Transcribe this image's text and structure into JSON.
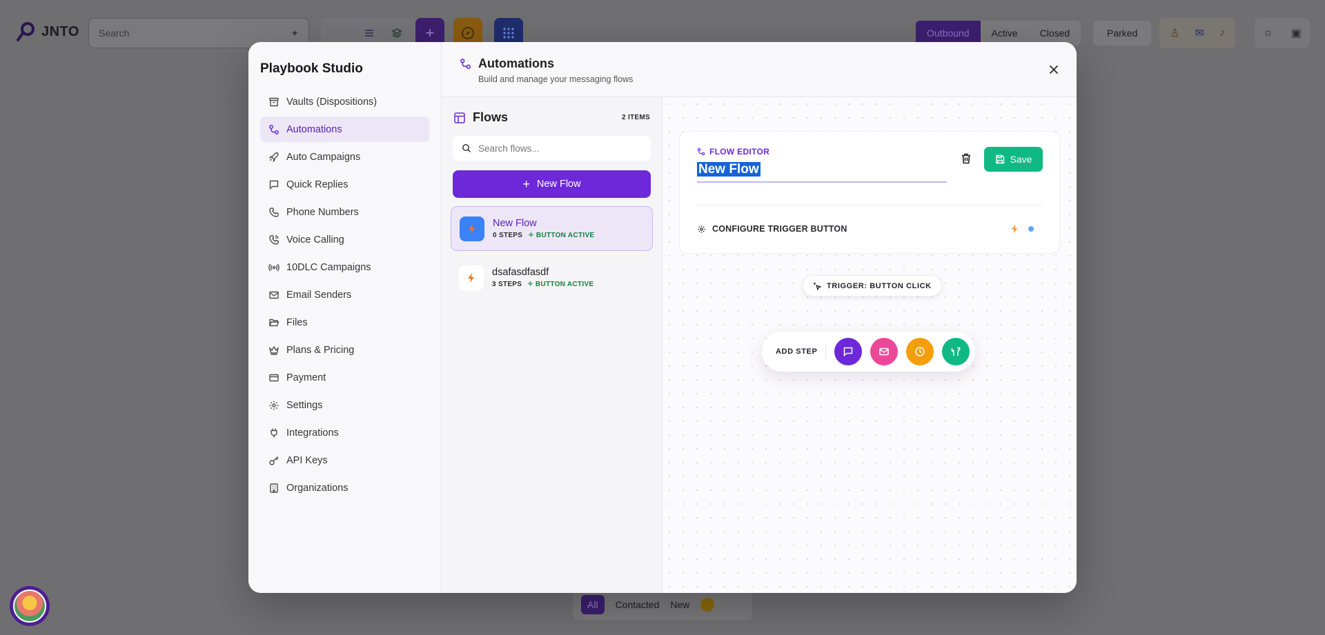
{
  "background": {
    "logo_text": "JNTO",
    "search_placeholder": "Search",
    "segments": [
      "Outbound",
      "Active",
      "Closed"
    ],
    "parked_label": "Parked",
    "bottom_tabs": [
      "All",
      "Contacted",
      "New"
    ]
  },
  "sidebar": {
    "title": "Playbook Studio",
    "items": [
      {
        "label": "Vaults (Dispositions)",
        "icon": "archive-icon"
      },
      {
        "label": "Automations",
        "icon": "workflow-icon",
        "active": true
      },
      {
        "label": "Auto Campaigns",
        "icon": "rocket-icon"
      },
      {
        "label": "Quick Replies",
        "icon": "message-square-icon"
      },
      {
        "label": "Phone Numbers",
        "icon": "phone-icon"
      },
      {
        "label": "Voice Calling",
        "icon": "phone-call-icon"
      },
      {
        "label": "10DLC Campaigns",
        "icon": "radio-icon"
      },
      {
        "label": "Email Senders",
        "icon": "mail-icon"
      },
      {
        "label": "Files",
        "icon": "folder-open-icon"
      },
      {
        "label": "Plans & Pricing",
        "icon": "crown-icon"
      },
      {
        "label": "Payment",
        "icon": "credit-card-icon"
      },
      {
        "label": "Settings",
        "icon": "gear-icon"
      },
      {
        "label": "Integrations",
        "icon": "plug-icon"
      },
      {
        "label": "API Keys",
        "icon": "key-icon"
      },
      {
        "label": "Organizations",
        "icon": "building-icon"
      }
    ]
  },
  "header": {
    "title": "Automations",
    "subtitle": "Build and manage your messaging flows"
  },
  "flows": {
    "title": "Flows",
    "count_label": "2 ITEMS",
    "search_placeholder": "Search flows...",
    "new_button_label": "New Flow",
    "items": [
      {
        "name": "New Flow",
        "steps": "0 STEPS",
        "status": "BUTTON ACTIVE",
        "selected": true
      },
      {
        "name": "dsafasdfasdf",
        "steps": "3 STEPS",
        "status": "BUTTON ACTIVE",
        "selected": false
      }
    ]
  },
  "editor": {
    "label": "FLOW EDITOR",
    "flow_name": "New Flow",
    "save_label": "Save",
    "configure_label": "CONFIGURE TRIGGER BUTTON"
  },
  "canvas": {
    "trigger_label": "TRIGGER: BUTTON CLICK",
    "add_step_label": "ADD STEP",
    "step_types": [
      {
        "icon": "message-icon",
        "color": "#6d28d9"
      },
      {
        "icon": "mail-icon",
        "color": "#ec4899"
      },
      {
        "icon": "clock-icon",
        "color": "#f59e0b"
      },
      {
        "icon": "split-icon",
        "color": "#10b981"
      }
    ]
  },
  "colors": {
    "accent": "#6d28d9",
    "success": "#10b981",
    "status_active": "#15803d"
  }
}
